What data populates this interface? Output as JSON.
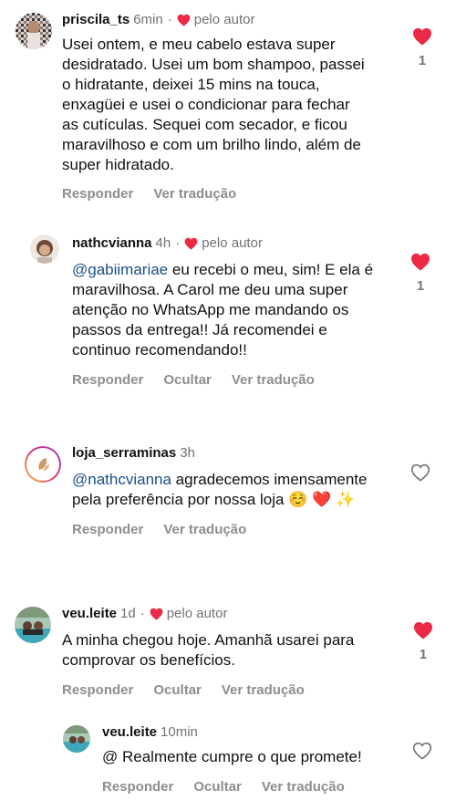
{
  "comments": [
    {
      "username": "priscila_ts",
      "time": "6min",
      "by_author": "pelo autor",
      "text": "Usei ontem, e meu cabelo estava super desidratado. Usei um bom shampoo, passei o hidratante, deixei 15 mins na touca, enxagüei e usei o condicionar para fechar as cutículas. Sequei com secador, e ficou maravilhoso e com um brilho lindo, além de super hidratado.",
      "actions": [
        "Responder",
        "Ver tradução"
      ],
      "likes": "1",
      "liked": true
    },
    {
      "username": "nathcvianna",
      "time": "4h",
      "by_author": "pelo autor",
      "mention": "@gabiimariae",
      "text": " eu recebi o meu, sim! E ela é maravilhosa. A Carol me deu uma super atenção no WhatsApp me mandando os passos da entrega!! Já recomendei e continuo recomendando!!",
      "actions": [
        "Responder",
        "Ocultar",
        "Ver tradução"
      ],
      "likes": "1",
      "liked": true
    },
    {
      "username": "loja_serraminas",
      "time": "3h",
      "mention": "@nathcvianna",
      "text": " agradecemos imensamente pela preferência por nossa loja ",
      "emojis": "☺️ ❤️ ✨",
      "actions": [
        "Responder",
        "Ver tradução"
      ],
      "liked": false
    },
    {
      "username": "veu.leite",
      "time": "1d",
      "by_author": "pelo autor",
      "text": "A minha chegou hoje. Amanhã usarei para comprovar os benefícios.",
      "actions": [
        "Responder",
        "Ocultar",
        "Ver tradução"
      ],
      "likes": "1",
      "liked": true
    },
    {
      "username": "veu.leite",
      "time": "10min",
      "text": "@ Realmente cumpre o que promete!",
      "actions": [
        "Responder",
        "Ocultar",
        "Ver tradução"
      ],
      "liked": false
    }
  ],
  "colors": {
    "like_red": "#ed2a45",
    "mention_blue": "#1c4f86",
    "muted": "#737373"
  },
  "icons": [
    "heart-icon",
    "heart-outline-icon"
  ]
}
